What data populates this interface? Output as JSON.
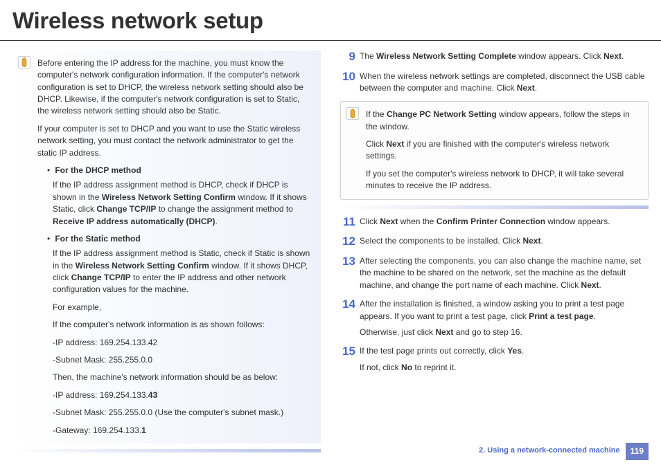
{
  "title": "Wireless network setup",
  "left": {
    "note": {
      "p1": "Before entering the IP address for the machine, you must know the computer's network configuration information. If the computer's network configuration is set to DHCP, the wireless network setting should also be DHCP. Likewise, if the computer's network configuration is set to Static, the wireless network setting should also be Static.",
      "p2": "If your computer is set to DHCP and you want to use the Static wireless network setting, you must contact the network administrator to get the static IP address.",
      "dhcp_head": "For the DHCP method",
      "dhcp_body_a": "If the IP address assignment method is DHCP, check if DHCP is shown in the ",
      "dhcp_body_b": "Wireless Network Setting Confirm",
      "dhcp_body_c": " window. If it shows Static, click ",
      "dhcp_body_d": "Change TCP/IP",
      "dhcp_body_e": " to change the assignment method to ",
      "dhcp_body_f": "Receive IP address automatically (DHCP)",
      "static_head": "For the Static method",
      "static_a": "If the IP address assignment method is Static, check if Static is shown in the ",
      "static_b": "Wireless Network Setting Confirm",
      "static_c": " window. If it shows DHCP, click ",
      "static_d": "Change TCP/IP",
      "static_e": " to enter the IP address and other network configuration values for the machine.",
      "ex_label": "For example,",
      "ex1": "If the computer's network information is as shown follows:",
      "ip1": "-IP address: 169.254.133.42",
      "mask1": "-Subnet Mask: 255.255.0.0",
      "then": "Then, the machine's network information should be as below:",
      "ip2a": "-IP address: 169.254.133.",
      "ip2b": "43",
      "mask2": "-Subnet Mask: 255.255.0.0 (Use the computer's subnet mask.)",
      "gw_a": "-Gateway: 169.254.133.",
      "gw_b": "1"
    }
  },
  "right": {
    "steps_a": [
      {
        "num": "9",
        "parts": [
          {
            "t": "The "
          },
          {
            "t": "Wireless Network Setting Complete",
            "b": true
          },
          {
            "t": " window appears. Click "
          },
          {
            "t": "Next",
            "b": true
          },
          {
            "t": "."
          }
        ]
      },
      {
        "num": "10",
        "parts": [
          {
            "t": "When the wireless network settings are completed, disconnect the USB cable between the computer and machine. Click "
          },
          {
            "t": "Next",
            "b": true
          },
          {
            "t": "."
          }
        ]
      }
    ],
    "note": {
      "p1a": "If the ",
      "p1b": "Change PC Network Setting",
      "p1c": " window appears, follow the steps in the window.",
      "p2a": "Click ",
      "p2b": "Next",
      "p2c": " if you are finished with the computer's wireless network settings.",
      "p3": "If you set the computer's wireless network to DHCP, it will take several minutes to receive the IP address."
    },
    "steps_b": [
      {
        "num": "11",
        "lines": [
          [
            {
              "t": "Click "
            },
            {
              "t": "Next",
              "b": true
            },
            {
              "t": " when the "
            },
            {
              "t": "Confirm Printer Connection",
              "b": true
            },
            {
              "t": " window appears."
            }
          ]
        ]
      },
      {
        "num": "12",
        "lines": [
          [
            {
              "t": "Select the components to be installed. Click "
            },
            {
              "t": "Next",
              "b": true
            },
            {
              "t": "."
            }
          ]
        ]
      },
      {
        "num": "13",
        "lines": [
          [
            {
              "t": "After selecting the components, you can also change the machine name, set the machine to be shared on the network, set the machine as the default machine, and change the port name of each machine. Click "
            },
            {
              "t": "Next",
              "b": true
            },
            {
              "t": "."
            }
          ]
        ]
      },
      {
        "num": "14",
        "lines": [
          [
            {
              "t": "After the installation is finished, a window asking you to print a test page appears. If you want to print a test page, click "
            },
            {
              "t": "Print a test page",
              "b": true
            },
            {
              "t": "."
            }
          ],
          [
            {
              "t": "Otherwise, just click "
            },
            {
              "t": "Next",
              "b": true
            },
            {
              "t": " and go to step 16."
            }
          ]
        ]
      },
      {
        "num": "15",
        "lines": [
          [
            {
              "t": "If the test page prints out correctly, click "
            },
            {
              "t": "Yes",
              "b": true
            },
            {
              "t": "."
            }
          ],
          [
            {
              "t": "If not, click "
            },
            {
              "t": "No",
              "b": true
            },
            {
              "t": " to reprint it."
            }
          ]
        ]
      }
    ]
  },
  "footer": {
    "section": "2.  Using a network-connected machine",
    "page": "119"
  }
}
